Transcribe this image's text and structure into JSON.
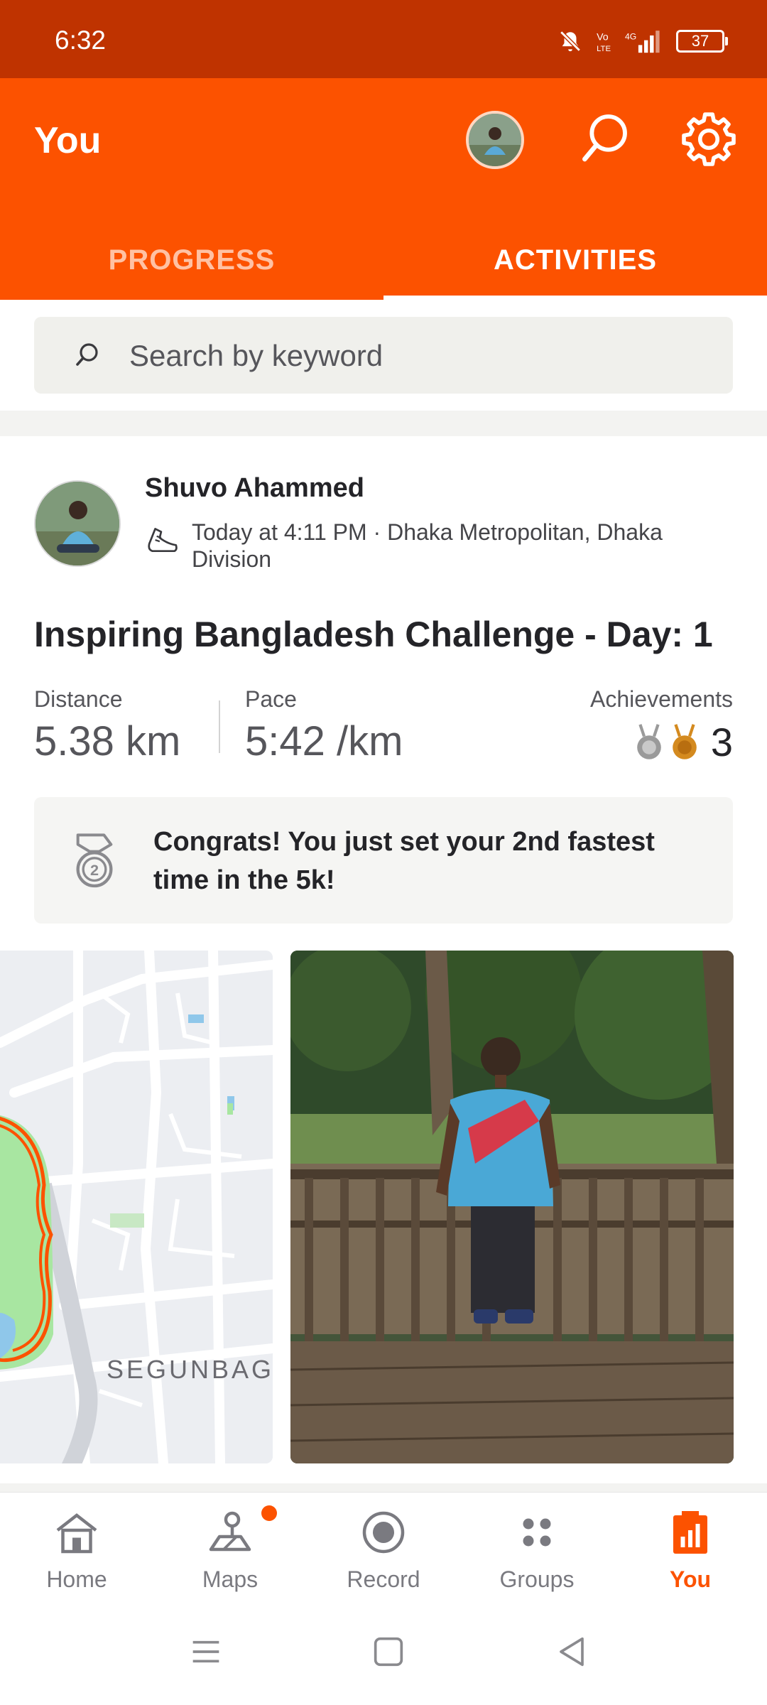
{
  "status_bar": {
    "time": "6:32",
    "battery": "37",
    "network": "4G"
  },
  "header": {
    "title": "You"
  },
  "tabs": [
    {
      "label": "PROGRESS",
      "selected": false
    },
    {
      "label": "ACTIVITIES",
      "selected": true
    }
  ],
  "search": {
    "placeholder": "Search by keyword"
  },
  "activity": {
    "athlete_name": "Shuvo Ahammed",
    "meta": "Today at 4:11 PM · Dhaka Metropolitan, Dhaka Division",
    "title": "Inspiring Bangladesh Challenge - Day: 1",
    "stats": {
      "distance_label": "Distance",
      "distance_value": "5.38 km",
      "pace_label": "Pace",
      "pace_value": "5:42 /km",
      "achievements_label": "Achievements",
      "achievements_count": "3"
    },
    "congrats": "Congrats! You just set your 2nd fastest time in the 5k!",
    "map_label": "SEGUNBAG"
  },
  "bottom_nav": [
    {
      "label": "Home",
      "icon": "home-icon"
    },
    {
      "label": "Maps",
      "icon": "maps-icon",
      "badge": true
    },
    {
      "label": "Record",
      "icon": "record-icon"
    },
    {
      "label": "Groups",
      "icon": "groups-icon"
    },
    {
      "label": "You",
      "icon": "you-icon",
      "active": true
    }
  ],
  "colors": {
    "brand": "#fc5200",
    "status_bar": "#bf3300"
  }
}
